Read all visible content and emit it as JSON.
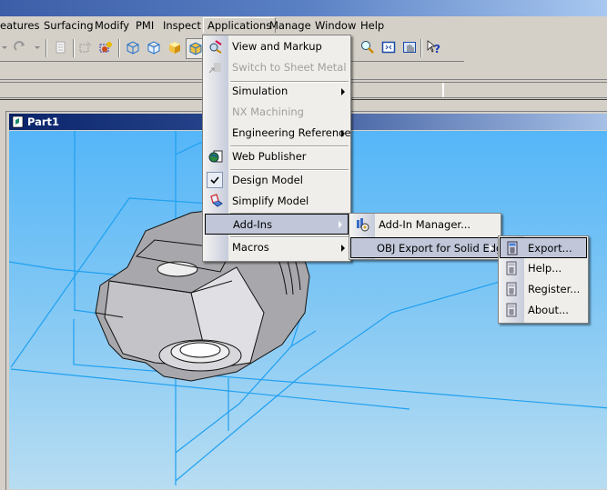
{
  "menubar": {
    "items": [
      {
        "label": "eatures"
      },
      {
        "label": "Surfacing"
      },
      {
        "label": "Modify"
      },
      {
        "label": "PMI"
      },
      {
        "label": "Inspect"
      },
      {
        "label": "Applications"
      },
      {
        "label": "Manage"
      },
      {
        "label": "Window"
      },
      {
        "label": "Help"
      }
    ]
  },
  "toolbar": {
    "icons": [
      "undo-arrow",
      "redo-arrow",
      "properties",
      "select-sketch",
      "select-part",
      "wireframe-box",
      "hidden-box",
      "shaded-box",
      "shaded-edges-box",
      "zoom-area",
      "fit",
      "pan",
      "whats-this-help"
    ]
  },
  "document": {
    "title": "Part1"
  },
  "applications_menu": {
    "items": [
      {
        "label": "View and Markup",
        "enabled": true,
        "icon": "view-markup-icon"
      },
      {
        "label": "Switch to Sheet Metal",
        "enabled": false,
        "icon": "sheet-metal-icon"
      },
      {
        "label": "Simulation",
        "enabled": true,
        "submenu": true
      },
      {
        "label": "NX Machining",
        "enabled": false
      },
      {
        "label": "Engineering Reference",
        "enabled": true,
        "submenu": true
      },
      {
        "label": "Web Publisher",
        "enabled": true,
        "icon": "web-publisher-icon"
      },
      {
        "label": "Design Model",
        "enabled": true,
        "checked": true
      },
      {
        "label": "Simplify Model",
        "enabled": true,
        "icon": "simplify-model-icon"
      },
      {
        "label": "Add-Ins",
        "enabled": true,
        "submenu": true,
        "highlighted": true
      },
      {
        "label": "Macros",
        "enabled": true,
        "submenu": true
      }
    ]
  },
  "addins_menu": {
    "items": [
      {
        "label": "Add-In Manager...",
        "icon": "addin-manager-icon"
      },
      {
        "label": "OBJ Export for Solid Edge",
        "submenu": true,
        "highlighted": true
      }
    ]
  },
  "obj_export_menu": {
    "items": [
      {
        "label": "Export...",
        "highlighted": true
      },
      {
        "label": "Help..."
      },
      {
        "label": "Register..."
      },
      {
        "label": "About..."
      }
    ]
  },
  "colors": {
    "menu_highlight": "#c1c7d9",
    "viewport_top": "#55b6f8",
    "viewport_bottom": "#b8ddf2",
    "construction_lines": "#1fa0f0",
    "doc_title": "#0a246a"
  }
}
